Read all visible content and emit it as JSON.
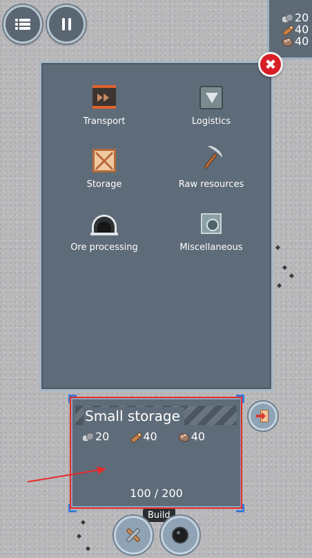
{
  "hud": {
    "menu_button": {
      "icon": "list-icon"
    },
    "pause_button": {
      "icon": "pause-icon"
    },
    "resources": [
      {
        "icon": "stone-icon",
        "value": "20"
      },
      {
        "icon": "wood-icon",
        "value": "40"
      },
      {
        "icon": "ore-icon",
        "value": "40"
      }
    ]
  },
  "build_menu": {
    "close_icon": "✖",
    "categories": [
      {
        "label": "Transport",
        "icon": "transport-icon"
      },
      {
        "label": "Logistics",
        "icon": "logistics-icon"
      },
      {
        "label": "Storage",
        "icon": "storage-icon"
      },
      {
        "label": "Raw resources",
        "icon": "pickaxe-icon"
      },
      {
        "label": "Ore processing",
        "icon": "ore-processing-icon"
      },
      {
        "label": "Miscellaneous",
        "icon": "misc-icon"
      }
    ]
  },
  "info_card": {
    "title": "Small storage",
    "costs": [
      {
        "icon": "stone-icon",
        "value": "20"
      },
      {
        "icon": "wood-icon",
        "value": "40"
      },
      {
        "icon": "ore-icon",
        "value": "40"
      }
    ],
    "capacity": "100 / 200"
  },
  "tooltip": {
    "label": "Build"
  },
  "colors": {
    "panel": "#5e6b78",
    "panel_border": "#a7b8ca",
    "close": "#d81f26",
    "annotation": "#e82a2a",
    "selection": "#3a7ad8"
  }
}
